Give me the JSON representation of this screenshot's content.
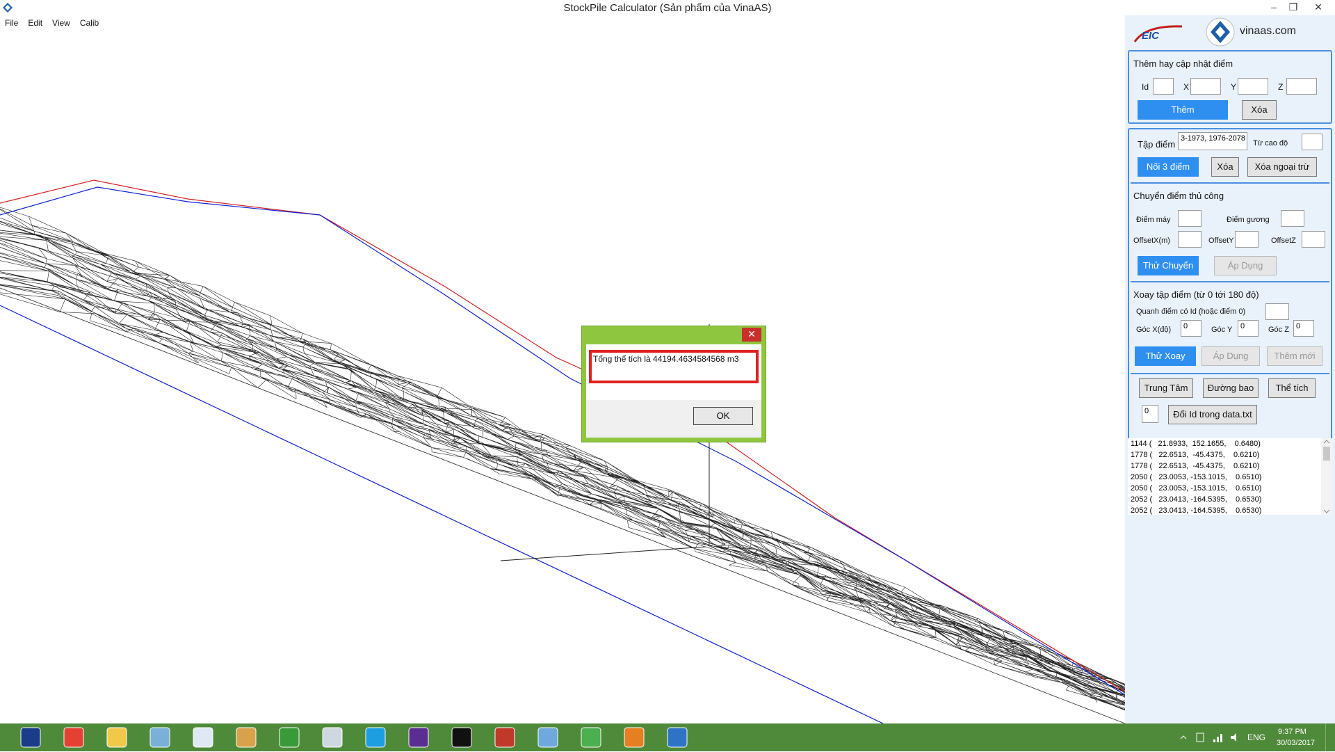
{
  "window": {
    "title": "StockPile Calculator (Sản phẩm của VinaAS)",
    "min_glyph": "–",
    "restore_glyph": "❐",
    "close_glyph": "✕"
  },
  "menu": [
    "File",
    "Edit",
    "View",
    "Calib"
  ],
  "logos": {
    "eic": "EIC",
    "site": "vinaas.com"
  },
  "add_point": {
    "title": "Thêm hay cập nhật điểm",
    "id_label": "Id",
    "x_label": "X",
    "y_label": "Y",
    "z_label": "Z",
    "add_button": "Thêm",
    "delete_button": "Xóa"
  },
  "point_set": {
    "label": "Tập điểm",
    "value": "3-1973, 1976-2078",
    "from_height_label": "Từ cao độ",
    "connect_button": "Nối 3 điểm",
    "delete_button": "Xóa",
    "delete_except_button": "Xóa ngoại trừ"
  },
  "manual_move": {
    "title": "Chuyển điểm thủ công",
    "machine_point_label": "Điểm máy",
    "mirror_point_label": "Điểm gương",
    "offset_x_label": "OffsetX(m)",
    "offset_y_label": "OffsetY",
    "offset_z_label": "OffsetZ",
    "try_button": "Thử Chuyển",
    "apply_button": "Áp Dụng"
  },
  "rotate": {
    "title": "Xoay tập điểm (từ 0 tới 180 độ)",
    "around_label": "Quanh điểm có Id (hoặc điểm 0)",
    "angle_x_label": "Góc X(độ)",
    "angle_x_value": "0",
    "angle_y_label": "Góc Y",
    "angle_y_value": "0",
    "angle_z_label": "Góc Z",
    "angle_z_value": "0",
    "try_button": "Thử Xoay",
    "apply_button": "Áp Dụng",
    "add_new_button": "Thêm mới"
  },
  "tools": {
    "center_button": "Trung Tâm",
    "boundary_button": "Đường bao",
    "volume_button": "Thể tích",
    "id_value": "0",
    "change_id_button": "Đổi Id trong data.txt"
  },
  "point_list": [
    "1144 (   21.8933,  152.1655,    0.6480)",
    "1778 (   22.6513,  -45.4375,    0.6210)",
    "1778 (   22.6513,  -45.4375,    0.6210)",
    "2050 (   23.0053, -153.1015,    0.6510)",
    "2050 (   23.0053, -153.1015,    0.6510)",
    "2052 (   23.0413, -164.5395,    0.6530)",
    "2052 (   23.0413, -164.5395,    0.6530)"
  ],
  "dialog": {
    "close_glyph": "✕",
    "message": "Tổng thể tích là 44194.4634584568 m3",
    "ok_button": "OK"
  },
  "taskbar": {
    "language": "ENG",
    "time": "9:37 PM",
    "date": "30/03/2017",
    "apps": [
      "save-icon",
      "chrome-icon",
      "folder-icon",
      "network-icon",
      "app-icon",
      "paint-icon",
      "notepad-icon",
      "image-viewer-icon",
      "skype-icon",
      "visual-studio-icon",
      "terminal-icon",
      "eclipse-icon",
      "window-icon",
      "calculator-icon",
      "pdf-icon",
      "vinaas-icon"
    ]
  },
  "colors": {
    "accent_blue": "#2f8ff0",
    "panel_bg": "#e9f2fb",
    "dialog_frame": "#8fc63f",
    "taskbar": "#4f8a3a",
    "highlight_red": "#e02020"
  }
}
